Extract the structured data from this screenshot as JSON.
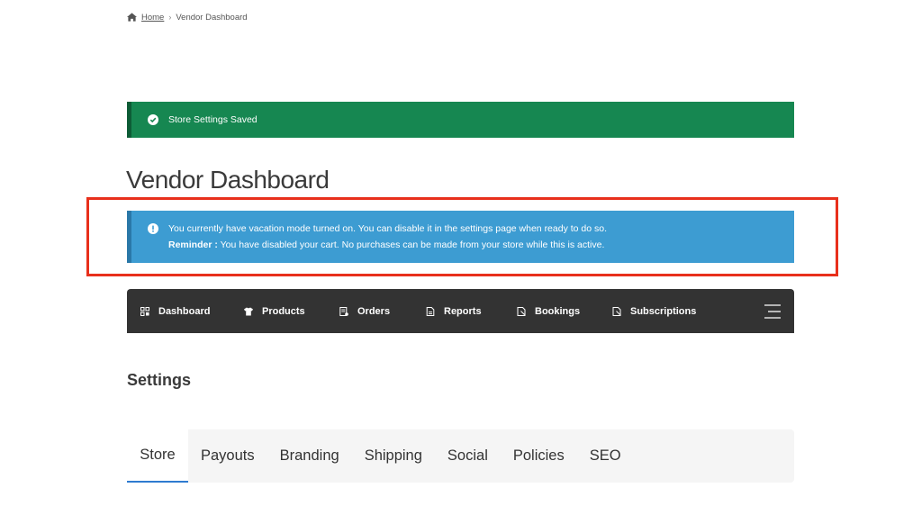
{
  "breadcrumb": {
    "home_label": "Home",
    "separator": "›",
    "current": "Vendor Dashboard"
  },
  "success_notice": {
    "message": "Store Settings Saved",
    "icon": "check-circle-icon",
    "color": "#168751"
  },
  "page_title": "Vendor Dashboard",
  "info_notice": {
    "line1": "You currently have vacation mode turned on. You can disable it in the settings page when ready to do so.",
    "reminder_label": "Reminder :",
    "reminder_text": " You have disabled your cart. No purchases can be made from your store while this is active.",
    "icon": "info-circle-icon",
    "color": "#3d9cd2"
  },
  "highlight_color": "#e8301c",
  "nav": {
    "items": [
      {
        "label": "Dashboard",
        "icon": "dashboard-icon"
      },
      {
        "label": "Products",
        "icon": "shirt-icon"
      },
      {
        "label": "Orders",
        "icon": "orders-icon"
      },
      {
        "label": "Reports",
        "icon": "reports-icon"
      },
      {
        "label": "Bookings",
        "icon": "bookings-icon"
      },
      {
        "label": "Subscriptions",
        "icon": "subscriptions-icon"
      }
    ],
    "menu_icon": "hamburger-icon",
    "background": "#333333"
  },
  "settings": {
    "title": "Settings",
    "tabs": [
      {
        "label": "Store",
        "active": true
      },
      {
        "label": "Payouts",
        "active": false
      },
      {
        "label": "Branding",
        "active": false
      },
      {
        "label": "Shipping",
        "active": false
      },
      {
        "label": "Social",
        "active": false
      },
      {
        "label": "Policies",
        "active": false
      },
      {
        "label": "SEO",
        "active": false
      }
    ],
    "active_color": "#2f7bd0"
  }
}
